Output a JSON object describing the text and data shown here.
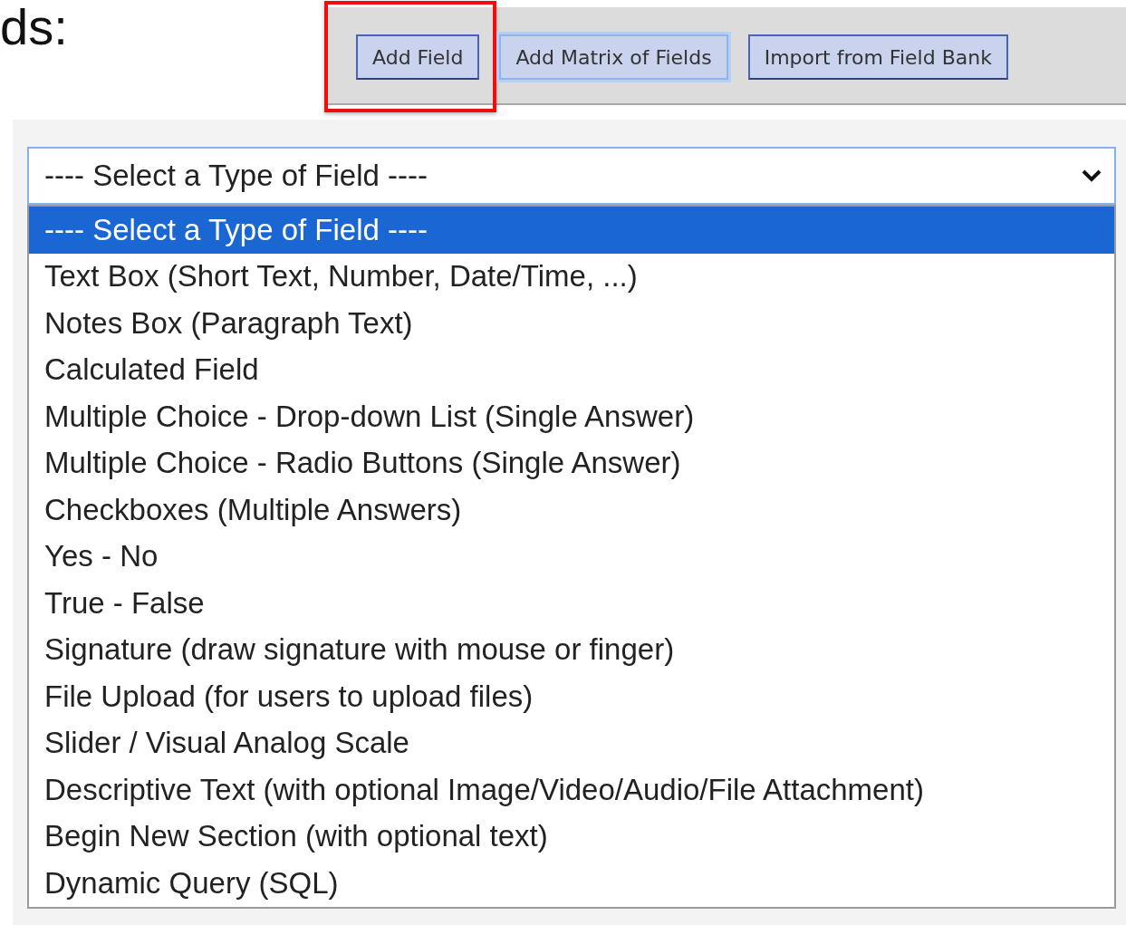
{
  "heading": "ds:",
  "toolbar": {
    "buttons": [
      {
        "label": "Add Field",
        "highlighted": true,
        "focused": false
      },
      {
        "label": "Add Matrix of Fields",
        "highlighted": false,
        "focused": true
      },
      {
        "label": "Import from Field Bank",
        "highlighted": false,
        "focused": false
      }
    ]
  },
  "field_type_select": {
    "value": "---- Select a Type of Field ----",
    "expanded": true,
    "options": [
      {
        "label": "---- Select a Type of Field ----",
        "selected": true
      },
      {
        "label": "Text Box (Short Text, Number, Date/Time, ...)",
        "selected": false
      },
      {
        "label": "Notes Box (Paragraph Text)",
        "selected": false
      },
      {
        "label": "Calculated Field",
        "selected": false
      },
      {
        "label": "Multiple Choice - Drop-down List (Single Answer)",
        "selected": false
      },
      {
        "label": "Multiple Choice - Radio Buttons (Single Answer)",
        "selected": false
      },
      {
        "label": "Checkboxes (Multiple Answers)",
        "selected": false
      },
      {
        "label": "Yes - No",
        "selected": false
      },
      {
        "label": "True - False",
        "selected": false
      },
      {
        "label": "Signature (draw signature with mouse or finger)",
        "selected": false
      },
      {
        "label": "File Upload (for users to upload files)",
        "selected": false
      },
      {
        "label": "Slider / Visual Analog Scale",
        "selected": false
      },
      {
        "label": "Descriptive Text (with optional Image/Video/Audio/File Attachment)",
        "selected": false
      },
      {
        "label": "Begin New Section (with optional text)",
        "selected": false
      },
      {
        "label": "Dynamic Query (SQL)",
        "selected": false
      }
    ]
  }
}
